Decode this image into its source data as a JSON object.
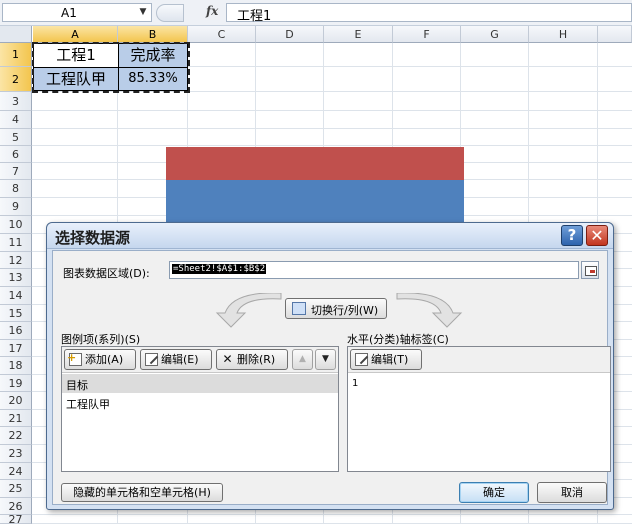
{
  "formula_bar": {
    "name_box": "A1",
    "fx_label": "fx",
    "formula": "工程1"
  },
  "sheet": {
    "columns": [
      "A",
      "B",
      "C",
      "D",
      "E",
      "F",
      "G",
      "H"
    ],
    "rows": [
      "1",
      "2",
      "3",
      "4",
      "5",
      "6",
      "7",
      "8",
      "9",
      "10",
      "11",
      "12",
      "13",
      "14",
      "15",
      "16",
      "17",
      "18",
      "19",
      "20",
      "21",
      "22",
      "23",
      "24",
      "25",
      "26",
      "27"
    ],
    "cells": {
      "A1": "工程1",
      "B1": "完成率",
      "A2": "工程队甲",
      "B2": "85.33%"
    }
  },
  "chart": {
    "colors": {
      "top_series": "#c0504d",
      "bottom_series": "#4f81bd"
    }
  },
  "dialog": {
    "title": "选择数据源",
    "help_label": "?",
    "close_label": "✕",
    "range_label": "图表数据区域(D):",
    "range_value": "=Sheet2!$A$1:$B$2",
    "switch_label": "切换行/列(W)",
    "legend_label": "图例项(系列)(S)",
    "axis_label": "水平(分类)轴标签(C)",
    "add_label": "添加(A)",
    "edit_label": "编辑(E)",
    "delete_label": "删除(R)",
    "move_up": "▲",
    "move_down": "▼",
    "axis_edit_label": "编辑(T)",
    "series": [
      "目标",
      "工程队甲"
    ],
    "axis_items": [
      "1"
    ],
    "hidden_cells_label": "隐藏的单元格和空单元格(H)",
    "ok_label": "确定",
    "cancel_label": "取消"
  }
}
